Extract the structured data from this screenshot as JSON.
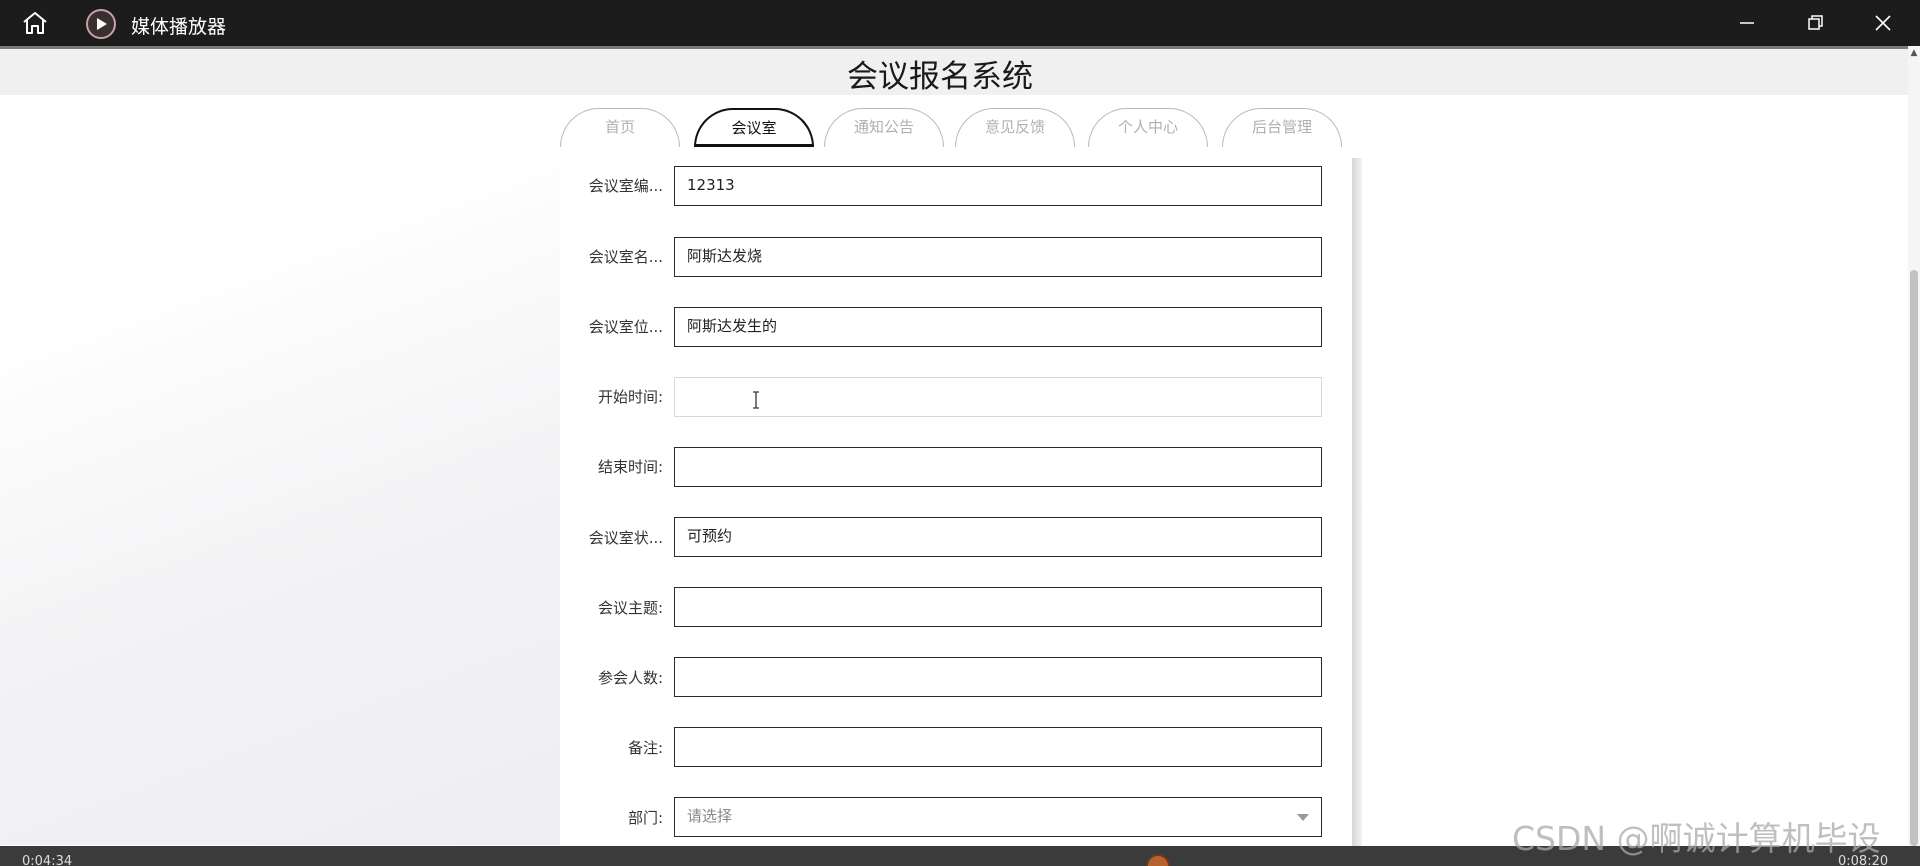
{
  "window": {
    "title": "媒体播放器",
    "home_icon": "home-icon",
    "logo_icon": "media-player-logo-icon",
    "minimize_icon": "minimize-icon",
    "maximize_icon": "restore-icon",
    "close_icon": "close-icon"
  },
  "page": {
    "title": "会议报名系统"
  },
  "tabs": [
    {
      "label": "首页",
      "active": false
    },
    {
      "label": "会议室",
      "active": true
    },
    {
      "label": "通知公告",
      "active": false
    },
    {
      "label": "意见反馈",
      "active": false
    },
    {
      "label": "个人中心",
      "active": false
    },
    {
      "label": "后台管理",
      "active": false
    }
  ],
  "form": {
    "fields": [
      {
        "label": "会议室编...",
        "value": "12313",
        "placeholder": ""
      },
      {
        "label": "会议室名...",
        "value": "阿斯达发烧",
        "placeholder": ""
      },
      {
        "label": "会议室位...",
        "value": "阿斯达发生的",
        "placeholder": ""
      },
      {
        "label": "开始时间:",
        "value": "",
        "placeholder": ""
      },
      {
        "label": "结束时间:",
        "value": "",
        "placeholder": ""
      },
      {
        "label": "会议室状...",
        "value": "可预约",
        "placeholder": ""
      },
      {
        "label": "会议主题:",
        "value": "",
        "placeholder": ""
      },
      {
        "label": "参会人数:",
        "value": "",
        "placeholder": ""
      },
      {
        "label": "备注:",
        "value": "",
        "placeholder": ""
      },
      {
        "label": "部门:",
        "value": "请选择",
        "placeholder": "请选择"
      }
    ]
  },
  "player": {
    "time_left": "0:04:34",
    "time_right": "0:08:20"
  },
  "watermark": "CSDN @啊诚计算机毕设",
  "colors": {
    "titlebar": "#1c1c1c",
    "header": "#f0f0f1",
    "active_tab_border": "#111111",
    "inactive_tab_text": "#b0b0b0",
    "player_knob": "#b8622c"
  }
}
